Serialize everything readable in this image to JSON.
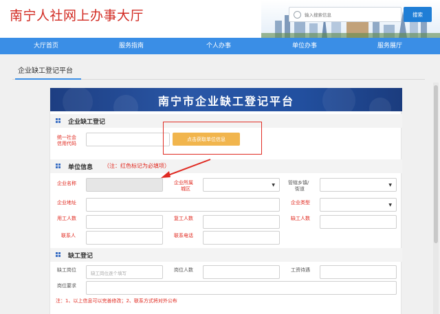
{
  "header": {
    "title": "南宁人社网上办事大厅",
    "search_placeholder": "输入搜索信息",
    "search_button": "搜索"
  },
  "nav": {
    "items": [
      "大厅首页",
      "服务指南",
      "个人办事",
      "单位办事",
      "服务展厅"
    ]
  },
  "breadcrumb": "企业缺工登记平台",
  "banner": {
    "title": "南宁市企业缺工登记平台"
  },
  "section1": {
    "title": "企业缺工登记",
    "credit_code_label_1": "统一社会",
    "credit_code_label_2": "信用代码",
    "fetch_button": "点击获取单位信息"
  },
  "section2": {
    "title": "单位信息",
    "note": "（注：红色标记为必填项）",
    "company_name_label": "企业名称",
    "district_label_1": "企业所属",
    "district_label_2": "城区",
    "town_label_1": "管辖乡镇/",
    "town_label_2": "街道",
    "address_label": "企业地址",
    "type_label": "企业类型",
    "employees_label": "用工人数",
    "returning_label": "复工人数",
    "shortage_label": "缺工人数",
    "contact_label": "联系人",
    "phone_label": "联系电话"
  },
  "section3": {
    "title": "缺工登记",
    "position_label": "缺工岗位",
    "position_placeholder": "缺工岗位逐个填写",
    "headcount_label": "岗位人数",
    "salary_label": "工资待遇",
    "requirement_label": "岗位要求"
  },
  "footnote": "注：1、以上信息可以完善修改；2、联系方式将对外公布",
  "colors": {
    "brand_red": "#d22a22",
    "nav_blue": "#3a8ee6",
    "banner_blue": "#2a57a6",
    "button_orange": "#f1b54d",
    "required_red": "#e0271d"
  }
}
